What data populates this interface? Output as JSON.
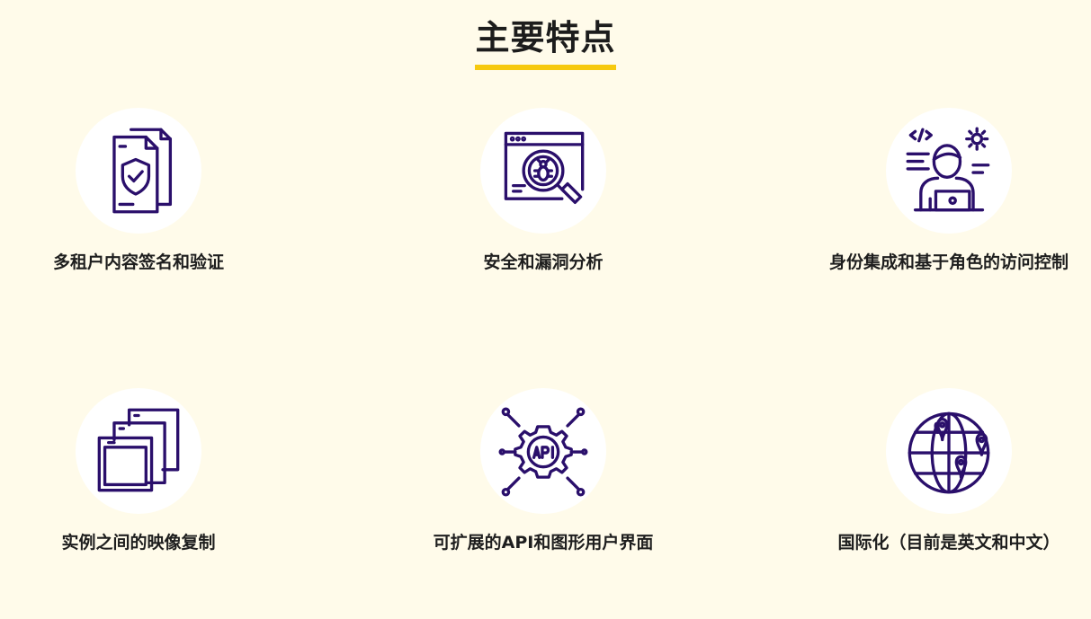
{
  "section": {
    "title": "主要特点"
  },
  "colors": {
    "background": "#fffbea",
    "accent_underline": "#f6c90e",
    "icon_stroke": "#2a0f6b",
    "icon_circle": "#ffffff"
  },
  "features": [
    {
      "icon": "signed-document-shield-icon",
      "label": "多租户内容签名和验证"
    },
    {
      "icon": "bug-scan-magnifier-icon",
      "label": "安全和漏洞分析"
    },
    {
      "icon": "developer-identity-gear-icon",
      "label": "身份集成和基于角色的访问控制"
    },
    {
      "icon": "stacked-copies-icon",
      "label": "实例之间的映像复制"
    },
    {
      "icon": "api-gear-network-icon",
      "label": "可扩展的API和图形用户界面"
    },
    {
      "icon": "globe-location-pins-icon",
      "label": "国际化（目前是英文和中文）"
    }
  ]
}
